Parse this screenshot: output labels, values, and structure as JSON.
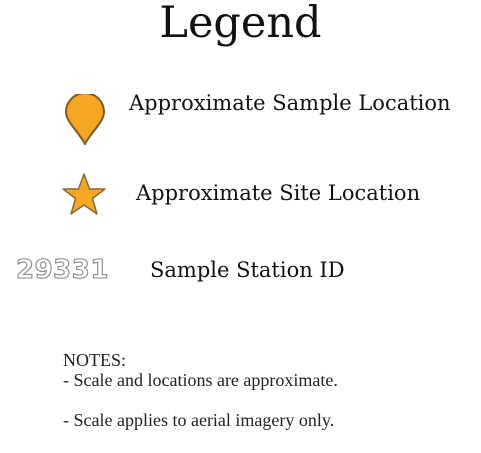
{
  "legend": {
    "title": "Legend",
    "items": [
      {
        "icon": "map-pin-icon",
        "label": "Approximate Sample Location",
        "color": "#F5A623",
        "outline": "#7a5a20"
      },
      {
        "icon": "star-icon",
        "label": "Approximate Site Location",
        "color": "#F5A623",
        "outline": "#8a6a30"
      },
      {
        "icon": "station-id-text",
        "example": "29331",
        "label": "Sample Station ID"
      }
    ]
  },
  "notes": {
    "heading": "NOTES:",
    "lines": [
      "- Scale and locations are approximate.",
      "- Scale applies to aerial imagery only."
    ]
  }
}
